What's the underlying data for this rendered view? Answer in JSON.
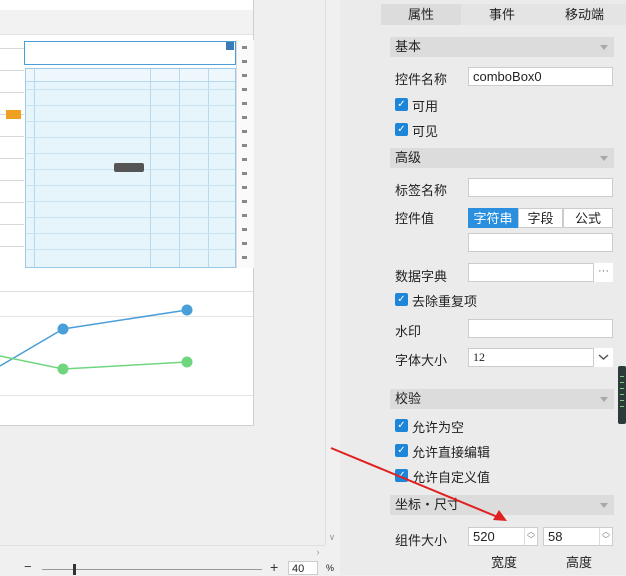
{
  "tabs": [
    {
      "label": "属性"
    },
    {
      "label": "事件"
    },
    {
      "label": "移动端"
    }
  ],
  "sections": {
    "basic": "基本",
    "advanced": "高级",
    "validation": "校验",
    "position_size": "坐标・尺寸"
  },
  "basic": {
    "control_name_label": "控件名称",
    "control_name_value": "comboBox0",
    "enabled_label": "可用",
    "visible_label": "可见"
  },
  "advanced": {
    "tag_name_label": "标签名称",
    "tag_name_value": "",
    "control_value_label": "控件值",
    "value_types": [
      "字符串",
      "字段",
      "公式"
    ],
    "value_types_selected": "字符串",
    "control_value_value": "",
    "data_dict_label": "数据字典",
    "data_dict_button": "···",
    "dedupe_label": "去除重复项",
    "watermark_label": "水印",
    "watermark_value": "",
    "font_size_label": "字体大小",
    "font_size_value": "12"
  },
  "validation": {
    "allow_empty_label": "允许为空",
    "allow_direct_edit_label": "允许直接编辑",
    "allow_custom_label": "允许自定义值"
  },
  "position_size": {
    "component_size_label": "组件大小",
    "width_value": "520",
    "height_value": "58",
    "width_label": "宽度",
    "height_label": "高度"
  },
  "zoom": {
    "value": "40",
    "unit": "%"
  },
  "colors": {
    "accent_blue": "#2b8fe0",
    "annotation_red": "#e02020",
    "line_blue": "#4a9fd8",
    "line_green": "#6fd67f"
  }
}
